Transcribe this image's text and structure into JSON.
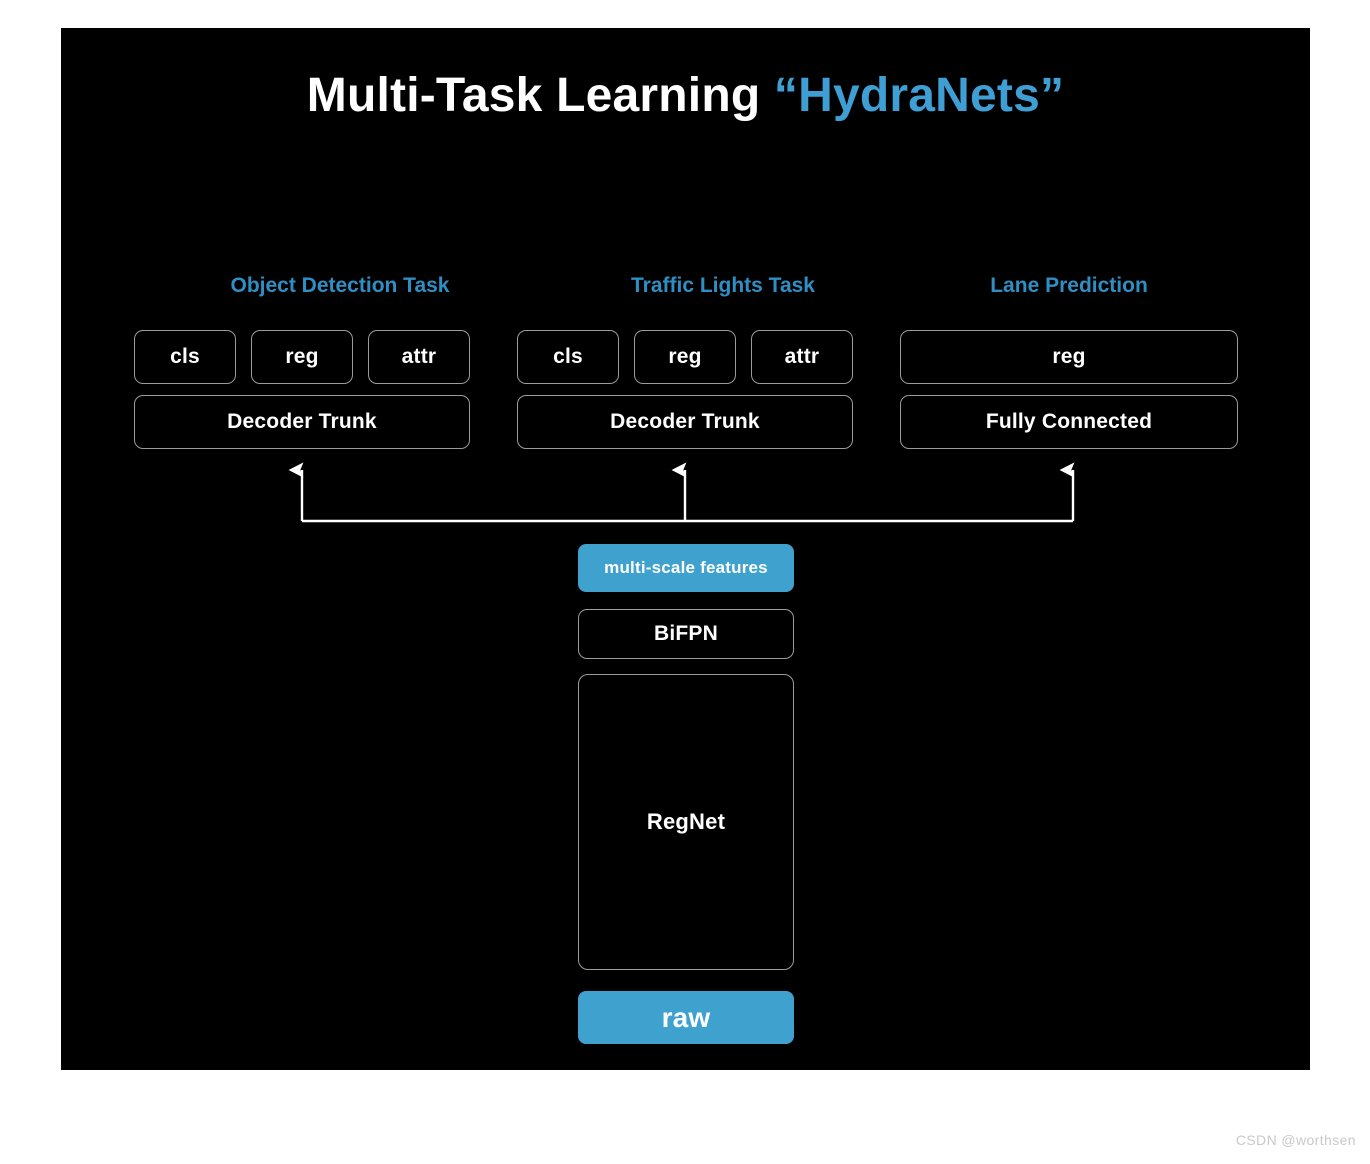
{
  "slide": {
    "background_color": "#000000",
    "accent_color": "#3fa2ce",
    "header_color": "#2f8fc4",
    "border_color": "#9b9b9b",
    "title": {
      "main": "Multi-Task Learning ",
      "accent": "“HydraNets”"
    }
  },
  "tasks": [
    {
      "header": "Object Detection Task",
      "heads": [
        "cls",
        "reg",
        "attr"
      ],
      "trunk": "Decoder Trunk"
    },
    {
      "header": "Traffic Lights Task",
      "heads": [
        "cls",
        "reg",
        "attr"
      ],
      "trunk": "Decoder Trunk"
    },
    {
      "header": "Lane Prediction",
      "heads": [
        "reg"
      ],
      "trunk": "Fully Connected"
    }
  ],
  "backbone": {
    "features": "multi-scale features",
    "neck": "BiFPN",
    "body": "RegNet",
    "input": "raw"
  },
  "watermark": "CSDN @worthsen"
}
